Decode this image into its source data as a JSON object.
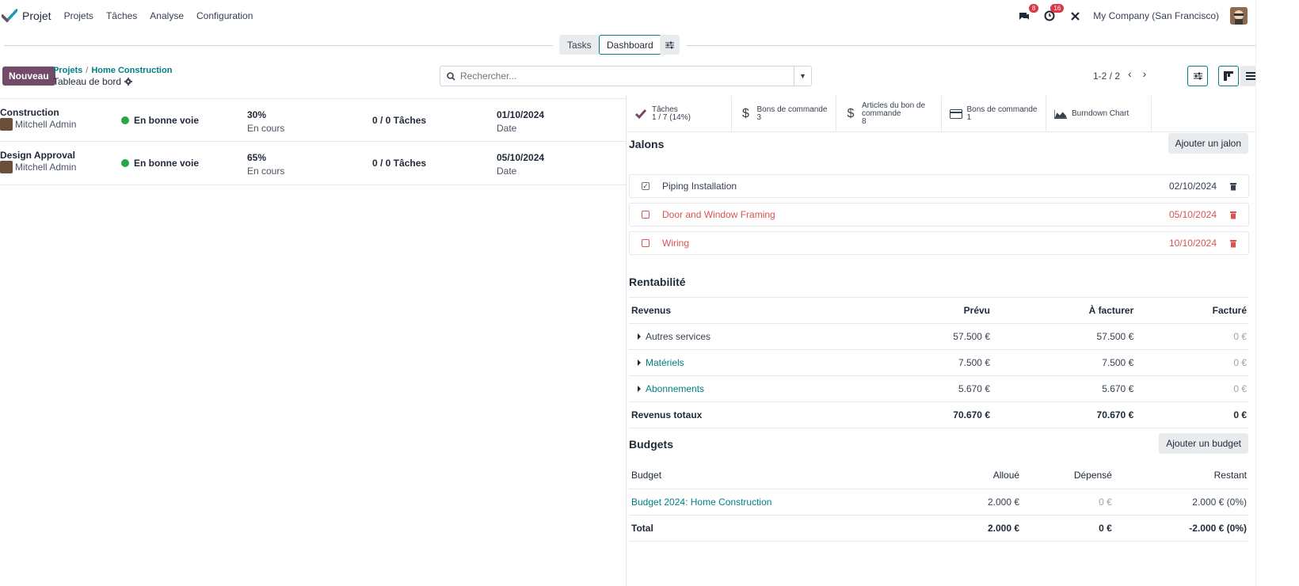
{
  "app": {
    "name": "Projet"
  },
  "menu": [
    "Projets",
    "Tâches",
    "Analyse",
    "Configuration"
  ],
  "nav": {
    "messages_count": "8",
    "activities_count": "16",
    "company": "My Company (San Francisco)"
  },
  "switcher": {
    "tasks": "Tasks",
    "dashboard": "Dashboard"
  },
  "control": {
    "new_button": "Nouveau",
    "breadcrumb_root": "Projets",
    "breadcrumb_sep": "/",
    "breadcrumb_project": "Home Construction",
    "current": "Tableau de bord",
    "search_placeholder": "Rechercher...",
    "pager": "1-2 / 2"
  },
  "projects": [
    {
      "name": "Construction",
      "user": "Mitchell Admin",
      "status": "En bonne voie",
      "progress": "30%",
      "progress_label": "En cours",
      "tasks": "0 / 0 Tâches",
      "date": "01/10/2024",
      "date_label": "Date"
    },
    {
      "name": "Design Approval",
      "user": "Mitchell Admin",
      "status": "En bonne voie",
      "progress": "65%",
      "progress_label": "En cours",
      "tasks": "0 / 0 Tâches",
      "date": "05/10/2024",
      "date_label": "Date"
    }
  ],
  "stats": [
    {
      "icon": "check-icon",
      "line1": "Tâches",
      "line2": "1 / 7 (14%)"
    },
    {
      "icon": "dollar-icon",
      "line1": "Bons de commande",
      "line2": "3"
    },
    {
      "icon": "dollar-icon",
      "line1": "Articles du bon de",
      "line2": "commande",
      "line3": "8"
    },
    {
      "icon": "credit-card-icon",
      "line1": "Bons de commande",
      "line2": "1"
    },
    {
      "icon": "area-chart-icon",
      "line1": "Burndown Chart",
      "line2": ""
    }
  ],
  "milestones": {
    "title": "Jalons",
    "add_button": "Ajouter un jalon",
    "items": [
      {
        "name": "Piping Installation",
        "date": "02/10/2024",
        "done": true,
        "late": false
      },
      {
        "name": "Door and Window Framing",
        "date": "05/10/2024",
        "done": false,
        "late": true
      },
      {
        "name": "Wiring",
        "date": "10/10/2024",
        "done": false,
        "late": true
      }
    ]
  },
  "profitability": {
    "title": "Rentabilité",
    "headers": [
      "Revenus",
      "Prévu",
      "À facturer",
      "Facturé"
    ],
    "rows": [
      {
        "label": "Autres services",
        "planned": "57.500 €",
        "to_invoice": "57.500 €",
        "invoiced": "0 €",
        "link": false
      },
      {
        "label": "Matériels",
        "planned": "7.500 €",
        "to_invoice": "7.500 €",
        "invoiced": "0 €",
        "link": true
      },
      {
        "label": "Abonnements",
        "planned": "5.670 €",
        "to_invoice": "5.670 €",
        "invoiced": "0 €",
        "link": true
      }
    ],
    "total": {
      "label": "Revenus totaux",
      "planned": "70.670 €",
      "to_invoice": "70.670 €",
      "invoiced": "0 €"
    }
  },
  "budgets": {
    "title": "Budgets",
    "add_button": "Ajouter un budget",
    "headers": [
      "Budget",
      "Alloué",
      "Dépensé",
      "Restant"
    ],
    "rows": [
      {
        "label": "Budget 2024: Home Construction",
        "allocated": "2.000 €",
        "spent": "0 €",
        "remaining": "2.000 € (0%)"
      }
    ],
    "total": {
      "label": "Total",
      "allocated": "2.000 €",
      "spent": "0 €",
      "remaining": "-2.000 € (0%)"
    }
  },
  "colors": {
    "brand": "#714b67",
    "accent": "#017e84",
    "success": "#28a745",
    "danger": "#d9534f"
  }
}
